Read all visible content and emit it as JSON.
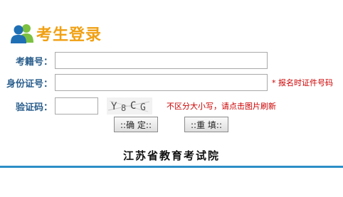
{
  "header": {
    "icon": "users-icon",
    "title": "考生登录"
  },
  "form": {
    "exam_number": {
      "label": "考籍号：",
      "value": "",
      "placeholder": ""
    },
    "id_number": {
      "label": "身份证号：",
      "value": "",
      "placeholder": "",
      "hint": "* 报名时证件号码"
    },
    "captcha": {
      "label": "验证码：",
      "value": "",
      "placeholder": "",
      "image_text": "Y8CG",
      "hint": "不区分大小写，请点击图片刷新"
    }
  },
  "buttons": {
    "confirm_label": "::确 定::",
    "reset_label": "::重 填::"
  },
  "footer": {
    "org_name": "江苏省教育考试院"
  },
  "colors": {
    "title": "#f0a012",
    "label": "#2a5e8c",
    "hint": "#cc0000",
    "footer_line": "#2c8fc7"
  }
}
